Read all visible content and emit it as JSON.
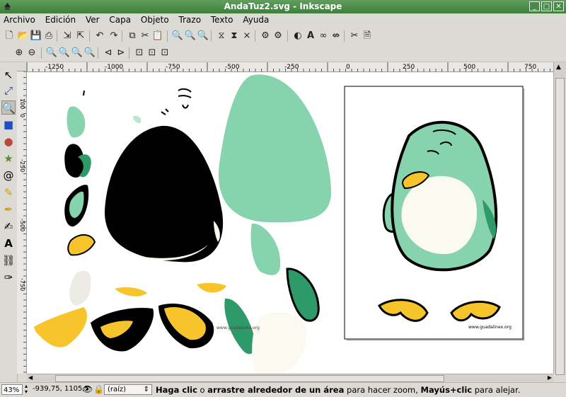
{
  "window": {
    "title": "AndaTuz2.svg - Inkscape"
  },
  "menu": [
    "Archivo",
    "Edición",
    "Ver",
    "Capa",
    "Objeto",
    "Trazo",
    "Texto",
    "Ayuda"
  ],
  "ruler": {
    "h_labels": [
      "-1250",
      "-1000",
      "-750",
      "-500",
      "-250",
      "0",
      "250",
      "500",
      "750"
    ],
    "v_labels": [
      "100",
      "0",
      "-250",
      "-500",
      "-750"
    ]
  },
  "page": {
    "footer_text": "www.guadalinex.org"
  },
  "status": {
    "zoom": "43%",
    "coords": "-939,75, 1105,5",
    "layer": "(raíz)",
    "message_bold1": "Haga clic",
    "message_text1": " o ",
    "message_bold2": "arrastre alrededor de un área",
    "message_text2": " para hacer zoom, ",
    "message_bold3": "Mayús+clic",
    "message_text3": " para alejar."
  },
  "colors": {
    "green_light": "#86d3ad",
    "green_dark": "#2e9a6a",
    "black": "#000000",
    "yellow": "#f7c52b",
    "cream": "#fbfaf0",
    "titlebar": "#4e8c4b"
  }
}
